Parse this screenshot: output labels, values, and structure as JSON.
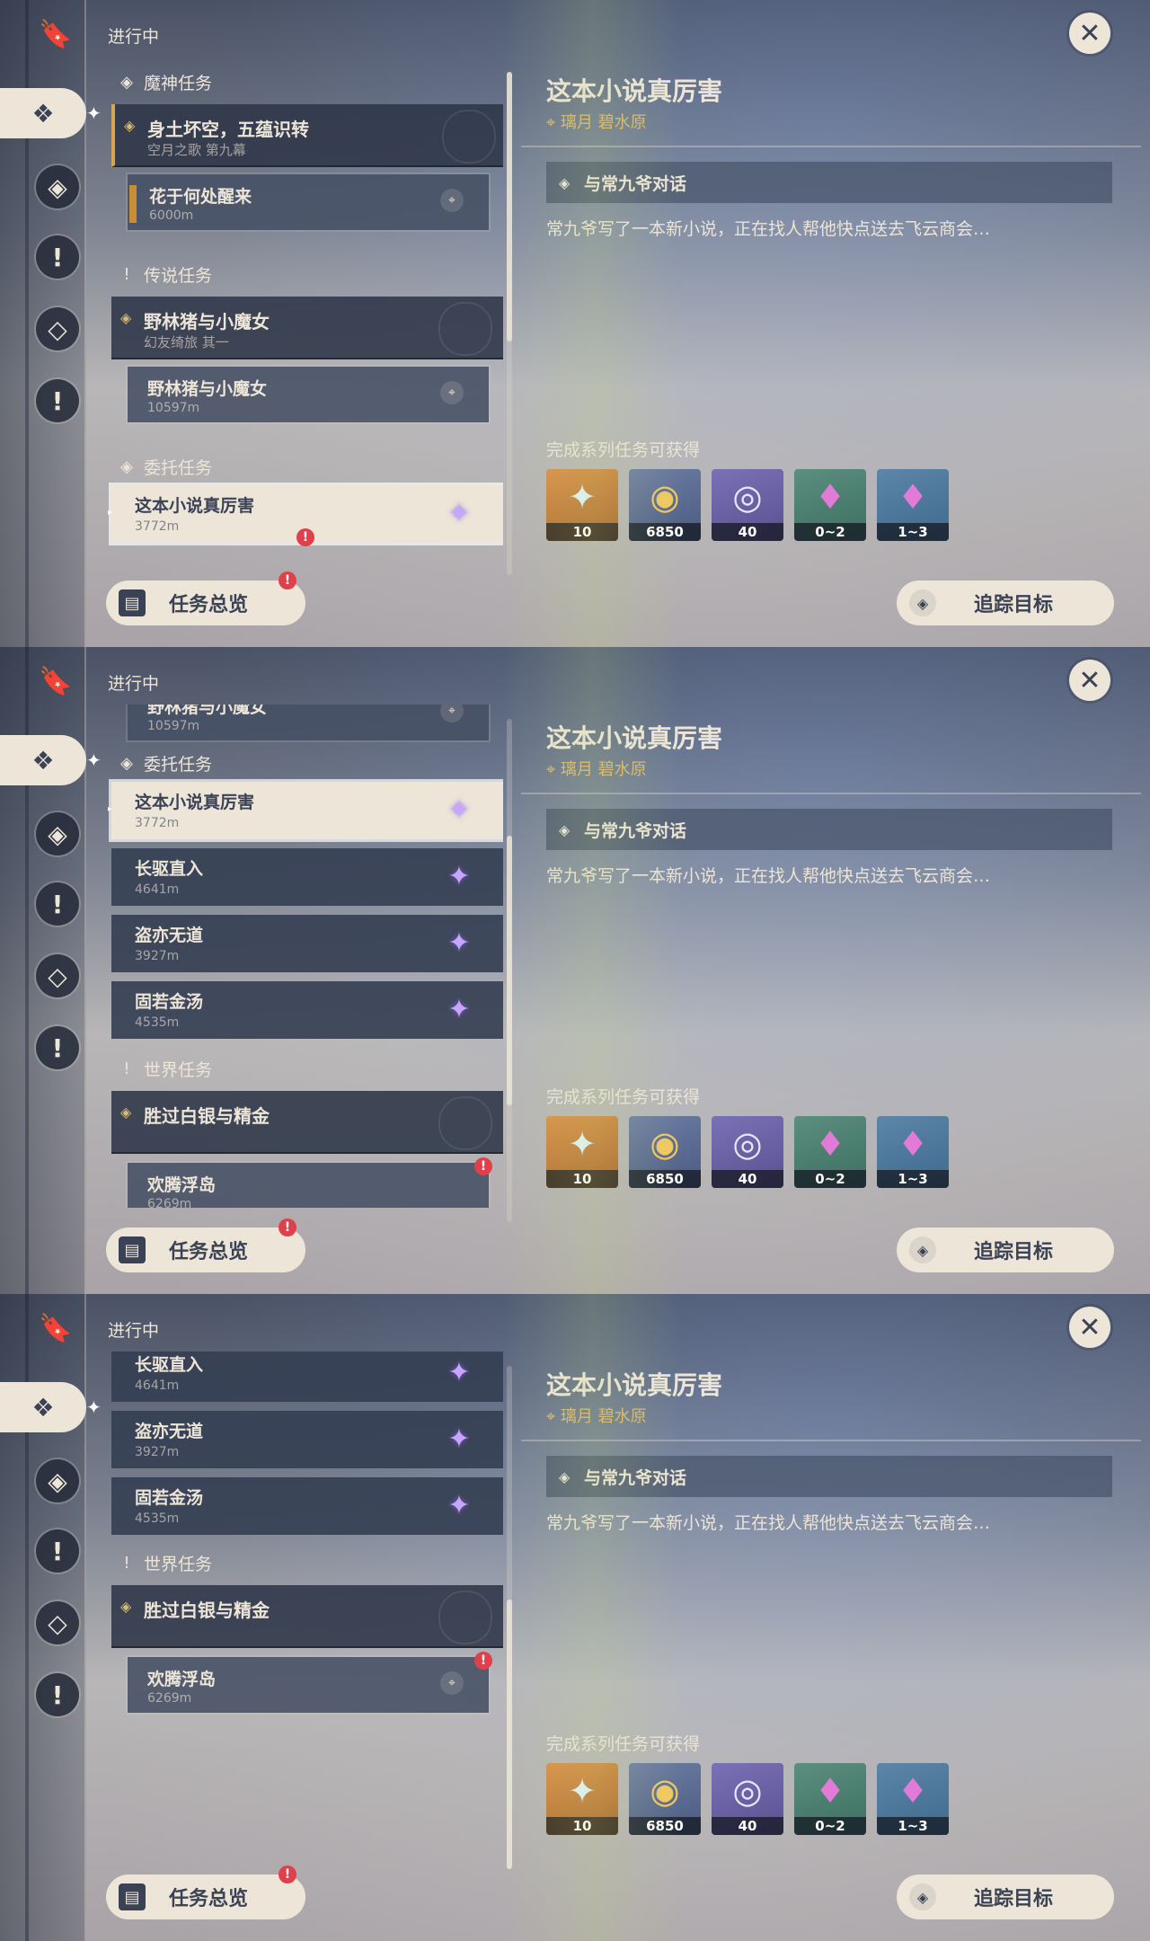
{
  "header": {
    "status": "进行中",
    "close_icon": "close-icon"
  },
  "rail": {
    "items": [
      "quest-banner-icon",
      "commission-icon",
      "archon-icon",
      "legend-icon",
      "world-icon",
      "exclaim-icon"
    ]
  },
  "categories": {
    "archon": "魔神任务",
    "legend": "传说任务",
    "commission": "委托任务",
    "world": "世界任务"
  },
  "quests": {
    "archon_series": {
      "title": "身土坏空，五蕴识转",
      "subtitle": "空月之歌 第九幕"
    },
    "archon_sub": {
      "title": "花于何处醒来",
      "distance": "6000m"
    },
    "legend_series": {
      "title": "野林猪与小魔女",
      "subtitle": "幻友绮旅 其一"
    },
    "legend_sub": {
      "title": "野林猪与小魔女",
      "distance": "10597m"
    },
    "commissions": [
      {
        "title": "这本小说真厉害",
        "distance": "3772m"
      },
      {
        "title": "长驱直入",
        "distance": "4641m"
      },
      {
        "title": "盗亦无道",
        "distance": "3927m"
      },
      {
        "title": "固若金汤",
        "distance": "4535m"
      }
    ],
    "world_series": {
      "title": "胜过白银与精金"
    },
    "world_sub": {
      "title": "欢腾浮岛",
      "distance": "6269m"
    }
  },
  "badge": "!",
  "buttons": {
    "overview": "任务总览",
    "track": "追踪目标"
  },
  "detail": {
    "title": "这本小说真厉害",
    "location": "璃月 碧水原",
    "step": "与常九爷对话",
    "description": "常九爷写了一本新小说，正在找人帮他快点送去飞云商会…",
    "rewards_label": "完成系列任务可获得",
    "rewards": [
      {
        "icon": "primogem-icon",
        "count": "10",
        "glyph": "✦"
      },
      {
        "icon": "mora-icon",
        "count": "6850",
        "glyph": "◉"
      },
      {
        "icon": "adventure-exp-icon",
        "count": "40",
        "glyph": "◎"
      },
      {
        "icon": "crystal-icon",
        "count": "0~2",
        "glyph": "♦"
      },
      {
        "icon": "crystal-cluster-icon",
        "count": "1~3",
        "glyph": "♦"
      }
    ]
  },
  "colors": {
    "accent": "#ece5d8",
    "gold": "#d8b970",
    "archon_bar": "#d8a452",
    "badge": "#e0404c"
  }
}
